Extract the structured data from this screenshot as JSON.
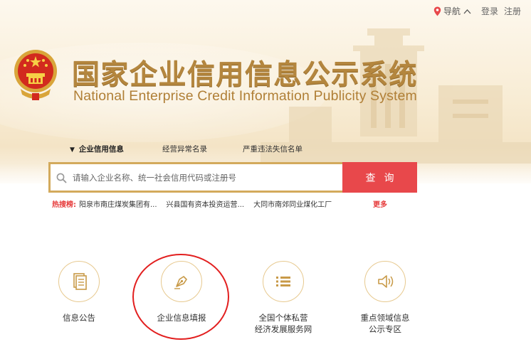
{
  "topbar": {
    "nav_label": "导航",
    "login": "登录",
    "register": "注册"
  },
  "header": {
    "title_cn": "国家企业信用信息公示系统",
    "title_en": "National Enterprise Credit Information Publicity System"
  },
  "tabs": [
    {
      "label": "企业信用信息",
      "active": true
    },
    {
      "label": "经营异常名录"
    },
    {
      "label": "严重违法失信名单"
    }
  ],
  "search": {
    "placeholder": "请输入企业名称、统一社会信用代码或注册号",
    "button": "查询"
  },
  "hot": {
    "label": "热搜榜:",
    "items": [
      "阳泉市南庄煤炭集团有...",
      "兴县国有资本投资运营...",
      "大同市南郊同业煤化工厂"
    ],
    "more": "更多"
  },
  "features": [
    {
      "label": "信息公告",
      "icon": "document-icon"
    },
    {
      "label": "企业信息填报",
      "icon": "pen-nib-icon"
    },
    {
      "label_line1": "全国个体私营",
      "label_line2": "经济发展服务网",
      "icon": "list-icon"
    },
    {
      "label_line1": "重点领域信息",
      "label_line2": "公示专区",
      "icon": "speaker-icon"
    }
  ],
  "colors": {
    "accent_gold": "#b4863e",
    "search_red": "#e8484b",
    "annotation_red": "#e21f1f",
    "hot_red": "#e63b3b"
  }
}
